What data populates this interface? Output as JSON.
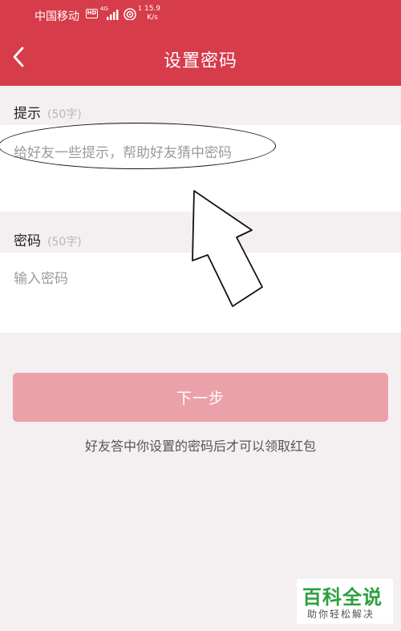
{
  "status_bar": {
    "carrier": "中国移动",
    "hd_label": "HD",
    "network_type": "4G",
    "wifi_number": "1",
    "speed_value": "15.9",
    "speed_unit": "K/s"
  },
  "header": {
    "title": "设置密码",
    "back_icon": "chevron-left-icon",
    "background_color": "#d63c4a"
  },
  "hint_section": {
    "label": "提示",
    "limit": "(50字)",
    "placeholder": "给好友一些提示，帮助好友猜中密码"
  },
  "password_section": {
    "label": "密码",
    "limit": "(50字)",
    "placeholder": "输入密码"
  },
  "next_button": {
    "label": "下一步",
    "color": "#eba1a8"
  },
  "footer_hint": "好友答中你设置的密码后才可以领取红包",
  "watermark": {
    "title": "百科全说",
    "subtitle": "助你轻松解决"
  }
}
